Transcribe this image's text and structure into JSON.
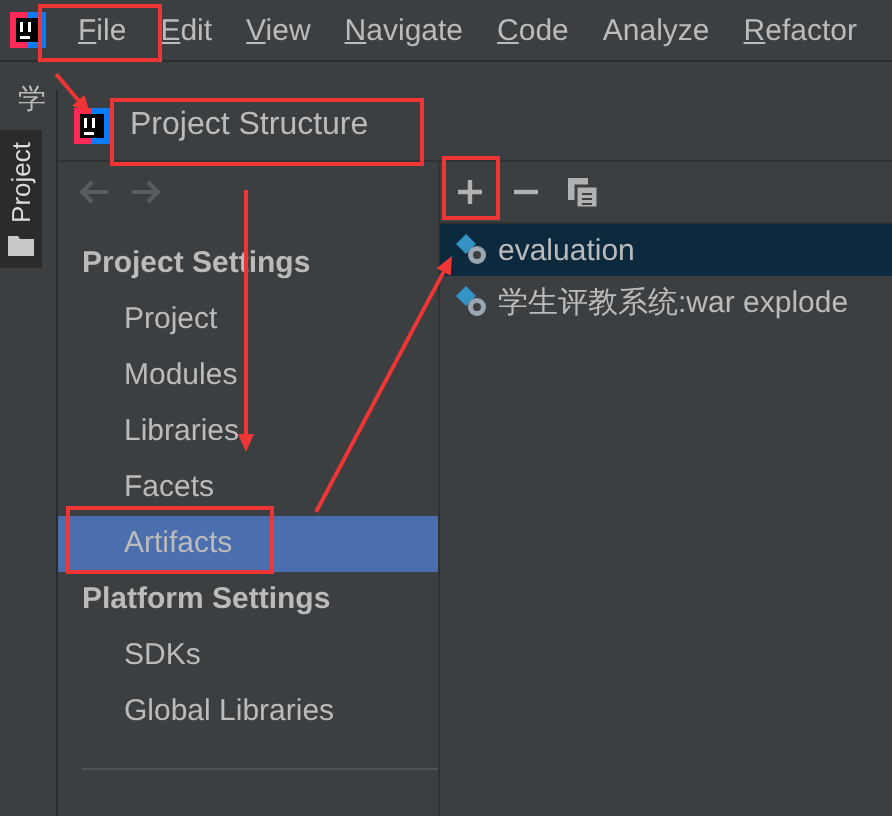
{
  "menu": [
    {
      "label": "File",
      "mnemonic": true
    },
    {
      "label": "Edit",
      "mnemonic": true
    },
    {
      "label": "View",
      "mnemonic": true
    },
    {
      "label": "Navigate",
      "mnemonic": true
    },
    {
      "label": "Code",
      "mnemonic": true
    },
    {
      "label": "Analyze",
      "mnemonic": false
    },
    {
      "label": "Refactor",
      "mnemonic": true
    }
  ],
  "editor_tab_glyph": "学",
  "tool_window": {
    "label": "Project",
    "selected": true
  },
  "dialog": {
    "title": "Project Structure",
    "sections": [
      {
        "title": "Project Settings",
        "items": [
          {
            "label": "Project",
            "selected": false
          },
          {
            "label": "Modules",
            "selected": false
          },
          {
            "label": "Libraries",
            "selected": false
          },
          {
            "label": "Facets",
            "selected": false
          },
          {
            "label": "Artifacts",
            "selected": true
          }
        ]
      },
      {
        "title": "Platform Settings",
        "items": [
          {
            "label": "SDKs",
            "selected": false
          },
          {
            "label": "Global Libraries",
            "selected": false
          }
        ]
      }
    ],
    "artifacts": [
      {
        "name": "evaluation",
        "selected": true
      },
      {
        "name": "学生评教系统:war explode",
        "selected": false
      }
    ]
  }
}
